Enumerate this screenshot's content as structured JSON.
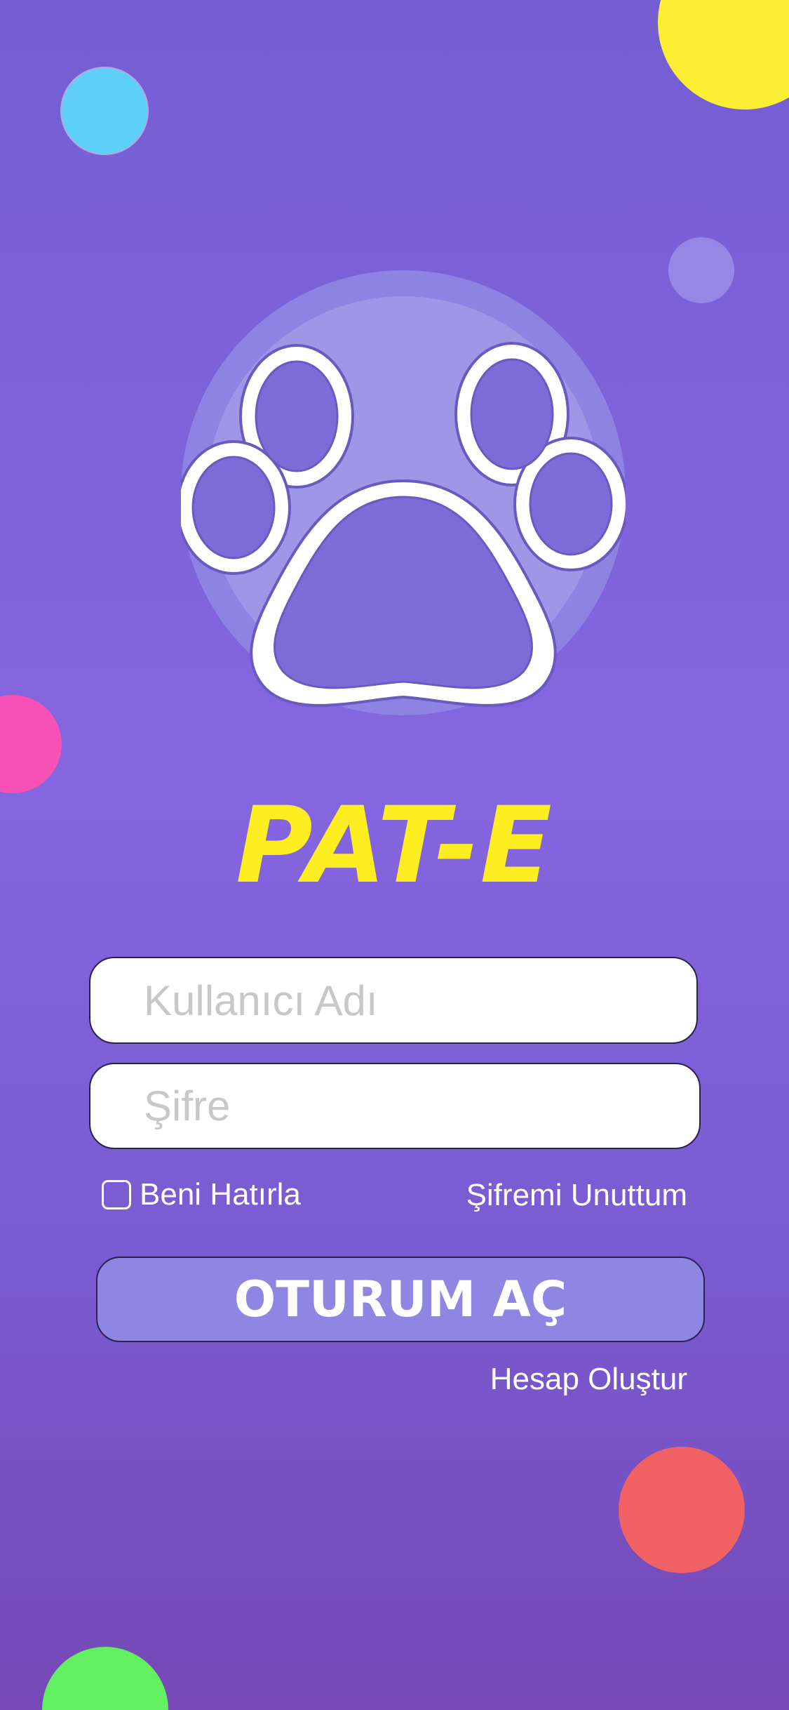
{
  "app": {
    "title": "PAT-E",
    "logo_icon": "paw-icon"
  },
  "form": {
    "username_placeholder": "Kullanıcı Adı",
    "password_placeholder": "Şifre",
    "remember_label": "Beni Hatırla",
    "remember_checked": false,
    "forgot_label": "Şifremi Unuttum",
    "login_label": "OTURUM AÇ",
    "create_account_label": "Hesap Oluştur"
  },
  "colors": {
    "background_top": "#745ed2",
    "background_bottom": "#7548b6",
    "title": "#fcee21",
    "button": "#8f86e3",
    "decor_blue": "#5ecff7",
    "decor_yellow": "#fcee33",
    "decor_lavender": "#9686e6",
    "decor_pink": "#f852b6",
    "decor_coral": "#f06264",
    "decor_green": "#62ef60"
  }
}
